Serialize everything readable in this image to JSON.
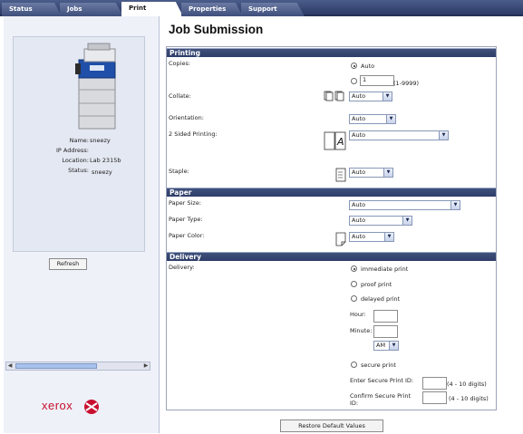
{
  "tabs": [
    {
      "label": "Status"
    },
    {
      "label": "Jobs"
    },
    {
      "label": "Print"
    },
    {
      "label": "Properties"
    },
    {
      "label": "Support"
    }
  ],
  "printer_info": {
    "name_label": "Name:",
    "name_value": "sneezy",
    "ip_label": "IP Address:",
    "ip_value": "",
    "location_label": "Location:",
    "location_value": "Lab 2315b",
    "status_label": "Status:",
    "status_value": "sneezy"
  },
  "refresh_label": "Refresh",
  "logo_text": "xerox",
  "page_title": "Job Submission",
  "printing": {
    "header": "Printing",
    "copies_label": "Copies:",
    "copies_auto": "Auto",
    "copies_value": "1",
    "copies_range": "(1-9999)",
    "collate_label": "Collate:",
    "collate_value": "Auto",
    "orientation_label": "Orientation:",
    "orientation_value": "Auto",
    "two_sided_label": "2 Sided Printing:",
    "two_sided_value": "Auto",
    "staple_label": "Staple:",
    "staple_value": "Auto"
  },
  "paper": {
    "header": "Paper",
    "size_label": "Paper Size:",
    "size_value": "Auto",
    "type_label": "Paper Type:",
    "type_value": "Auto",
    "color_label": "Paper Color:",
    "color_value": "Auto"
  },
  "delivery": {
    "header": "Delivery",
    "label": "Delivery:",
    "immediate": "immediate print",
    "proof": "proof print",
    "delayed": "delayed print",
    "hour_label": "Hour:",
    "minute_label": "Minute:",
    "ampm_value": "AM",
    "secure": "secure print",
    "enter_id_label": "Enter Secure Print ID:",
    "enter_id_hint": "(4 - 10 digits)",
    "confirm_id_label": "Confirm Secure Print ID:",
    "confirm_id_hint": "(4 - 10 digits)"
  },
  "restore_label": "Restore Default Values",
  "colors": {
    "header_bg": "#34436e",
    "tab_bg": "#4a5c8a",
    "logo_red": "#c8102e"
  }
}
